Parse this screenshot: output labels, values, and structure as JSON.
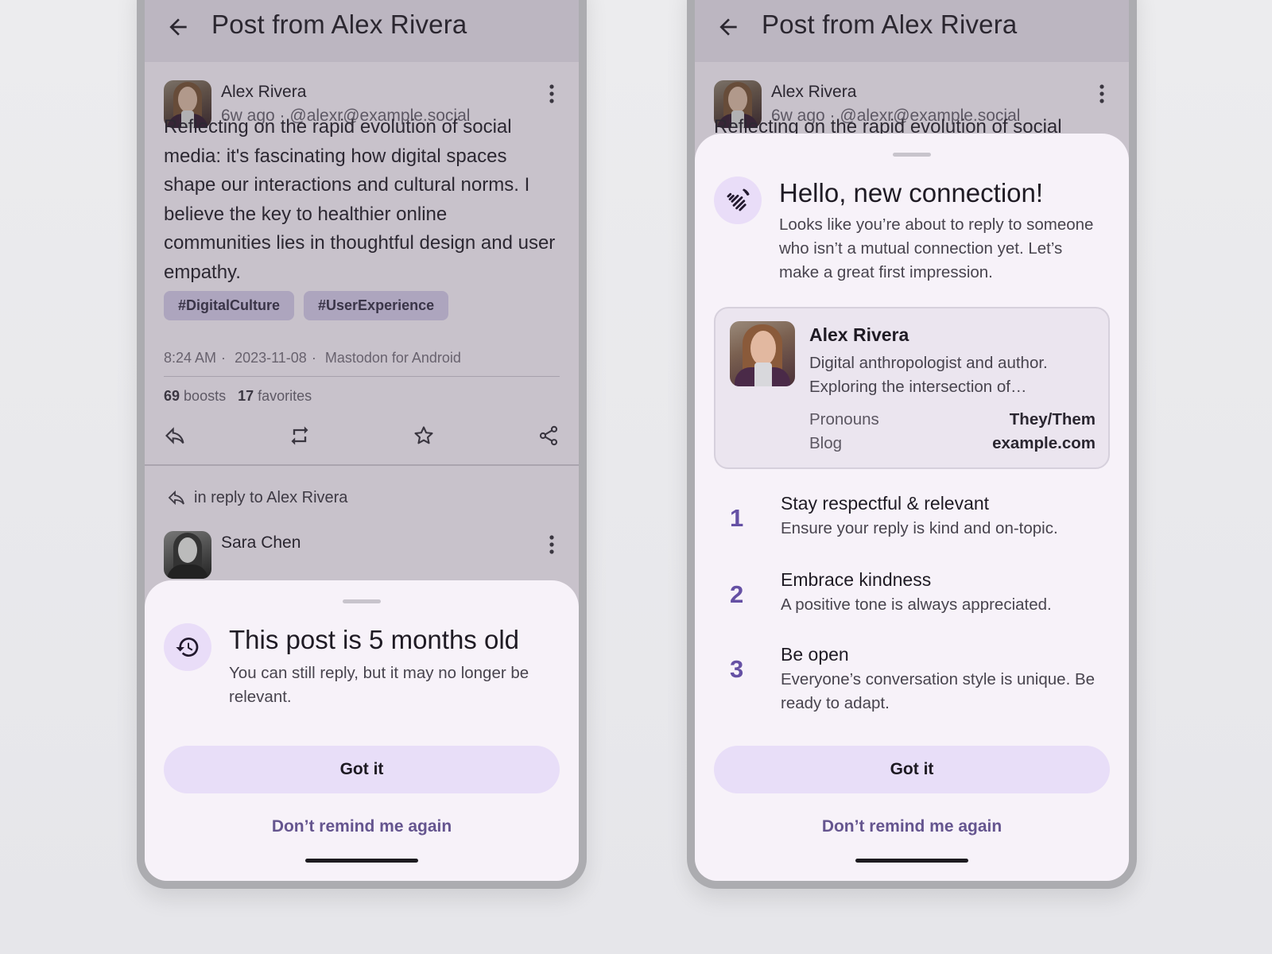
{
  "left": {
    "appbar": {
      "title": "Post from Alex Rivera"
    },
    "post": {
      "author": "Alex Rivera",
      "meta": "6w ago · @alexr@example.social",
      "text": "Reflecting on the rapid evolution of social media: it's fascinating how digital spaces shape our interactions and cultural norms. I believe the key to healthier online communities lies in thoughtful design and user empathy.",
      "tags": [
        "#DigitalCulture",
        "#UserExperience"
      ],
      "time": "8:24 AM",
      "date": "2023-11-08",
      "client": "Mastodon for Android",
      "boosts_count": "69",
      "boosts_label": "boosts",
      "favorites_count": "17",
      "favorites_label": "favorites"
    },
    "reply": {
      "label": "in reply to Alex Rivera",
      "author": "Sara Chen"
    },
    "sheet": {
      "title": "This post is 5 months old",
      "body": "You can still reply, but it may no longer be relevant.",
      "primary": "Got it",
      "secondary": "Don’t remind me again",
      "icon": "history-icon"
    }
  },
  "right": {
    "appbar": {
      "title": "Post from Alex Rivera"
    },
    "post": {
      "author": "Alex Rivera",
      "meta": "6w ago · @alexr@example.social",
      "text_peek": "Reflecting on the rapid evolution of social"
    },
    "sheet": {
      "title": "Hello, new connection!",
      "body": "Looks like you’re about to reply to someone who isn’t a mutual connection yet. Let’s make a great first impression.",
      "icon": "wave-hand-icon",
      "profile": {
        "name": "Alex Rivera",
        "bio": "Digital anthropologist and author. Exploring the intersection of…",
        "fields": [
          {
            "label": "Pronouns",
            "value": "They/Them"
          },
          {
            "label": "Blog",
            "value": "example.com"
          }
        ]
      },
      "steps": [
        {
          "num": "1",
          "title": "Stay respectful & relevant",
          "desc": "Ensure your reply is kind and on-topic."
        },
        {
          "num": "2",
          "title": "Embrace kindness",
          "desc": "A positive tone is always appreciated."
        },
        {
          "num": "3",
          "title": "Be open",
          "desc": "Everyone’s conversation style is unique. Be ready to adapt."
        }
      ],
      "primary": "Got it",
      "secondary": "Don’t remind me again"
    }
  },
  "colors": {
    "accent": "#65558f",
    "tonal_button": "#e8def8",
    "sheet_bg": "#f7f2f9",
    "scrim_bg": "#c8c2cb"
  }
}
